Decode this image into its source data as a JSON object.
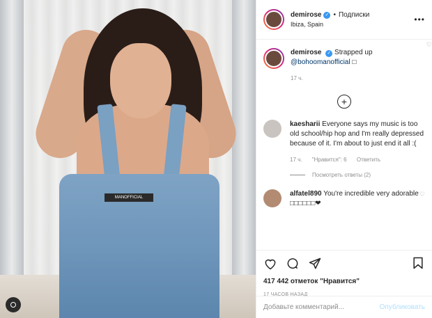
{
  "header": {
    "username": "demirose",
    "separator": "•",
    "follow_label": "Подписки",
    "location": "Ibiza, Spain",
    "more_label": "•••"
  },
  "caption": {
    "username": "demirose",
    "text": "Strapped up",
    "mention": "@bohoomanofficial",
    "emoji": "□",
    "time": "17 ч."
  },
  "load_more_label": "+",
  "comments": [
    {
      "username": "kaesharii",
      "text": "Everyone says my music is too old school/hip hop and I'm really depressed because of it. I'm about to just end it all :(",
      "time": "17 ч.",
      "likes": "\"Нравится\": 6",
      "reply_label": "Ответить",
      "view_replies": "Посмотреть ответы (2)"
    },
    {
      "username": "alfatel890",
      "text": "You're incredible very adorable □□□□□□❤"
    }
  ],
  "photo": {
    "patch_text": "MANOFFICIAL"
  },
  "post": {
    "likes": "417 442 отметок \"Нравится\"",
    "timestamp": "17 ЧАСОВ НАЗАД"
  },
  "comment_box": {
    "placeholder": "Добавьте комментарий...",
    "publish_label": "Опубликовать"
  }
}
